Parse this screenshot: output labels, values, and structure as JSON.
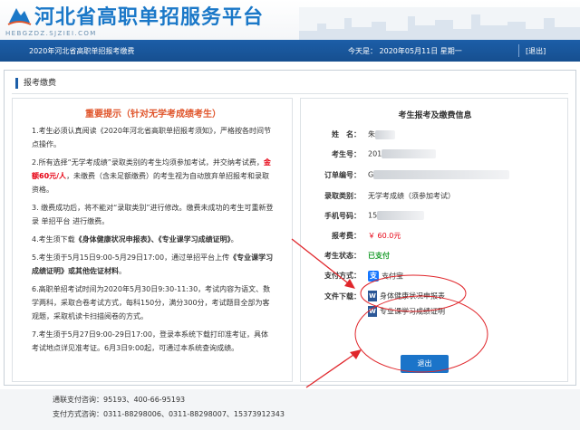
{
  "header": {
    "site_title": "河北省高职单招服务平台",
    "domain": "HEBGZDZ.SJZIEI.COM"
  },
  "bar": {
    "title": "2020年河北省高职单招报考缴费",
    "date": "今天是： 2020年05月11日 星期一",
    "logout": "[退出]"
  },
  "section": {
    "title": "报考缴费"
  },
  "notice": {
    "title": "重要提示（针对无学考成绩考生）",
    "p1": "1.考生必须认真阅读《2020年河北省高职单招报考须知》，严格按各时间节点操作。",
    "p2a": "2.所有选择“无学考成绩”录取类别的考生均须参加考试，并交纳考试费，",
    "p2b": "金额60元/人",
    "p2c": "，未缴费（含未足额缴费）的考生视为自动放弃单招报考和录取资格。",
    "p3": "3. 缴费成功后，将不能对“录取类别”进行修改。缴费未成功的考生可重新登录 单招平台 进行缴费。",
    "p4a": "4.考生须下载",
    "p4b": "《身体健康状况申报表》、《专业课学习成绩证明》",
    "p4c": "。",
    "p5a": "5.考生须于5月15日9:00-5月29日17:00，通过单招平台上传",
    "p5b": "《专业课学习成绩证明》或其他佐证材料",
    "p5c": "。",
    "p6": "6.高职单招考试时间为2020年5月30日9:30-11:30，考试内容为语文、数学两科，采取合卷考试方式，每科150分，满分300分，考试题目全部为客观题，采取机读卡扫描阅卷的方式。",
    "p7": "7.考生须于5月27日9:00-29日17:00，登录本系统下载打印准考证，具体考试地点详见准考证。6月3日9:00起，可通过本系统查询成绩。"
  },
  "info": {
    "title": "考生报考及缴费信息",
    "labels": {
      "name": "姓　名：",
      "exam_no": "考生号：",
      "order_no": "订单编号：",
      "category": "录取类别：",
      "phone": "手机号码：",
      "fee": "报考费：",
      "status": "考生状态：",
      "pay_method": "支付方式：",
      "files": "文件下载："
    },
    "name_value": "朱",
    "exam_no_value": "201",
    "order_no_value": "G",
    "category_value": "无学考成绩（须参加考试）",
    "phone_value": "15",
    "fee_value": "￥ 60.0元",
    "status_value": "已支付",
    "pay_method_value": "支付宝",
    "pay_icon": "alipay-icon",
    "file1": "身体健康状况申报表",
    "file2": "专业课学习成绩证明",
    "file_icon": "word-icon",
    "exit_label": "退出"
  },
  "footer": {
    "line1": "通联支付咨询：95193、400-66-95193",
    "line2": "支付方式咨询：0311-88298006、0311-88298007、15373912343"
  },
  "colors": {
    "primary": "#1c5ea8",
    "title_blue": "#1b78c8",
    "notice_title": "#e0552b",
    "red": "#e60012",
    "paid_green": "#1a9c2c",
    "annotation_red": "#e0262b",
    "alipay_blue": "#1677ff"
  }
}
